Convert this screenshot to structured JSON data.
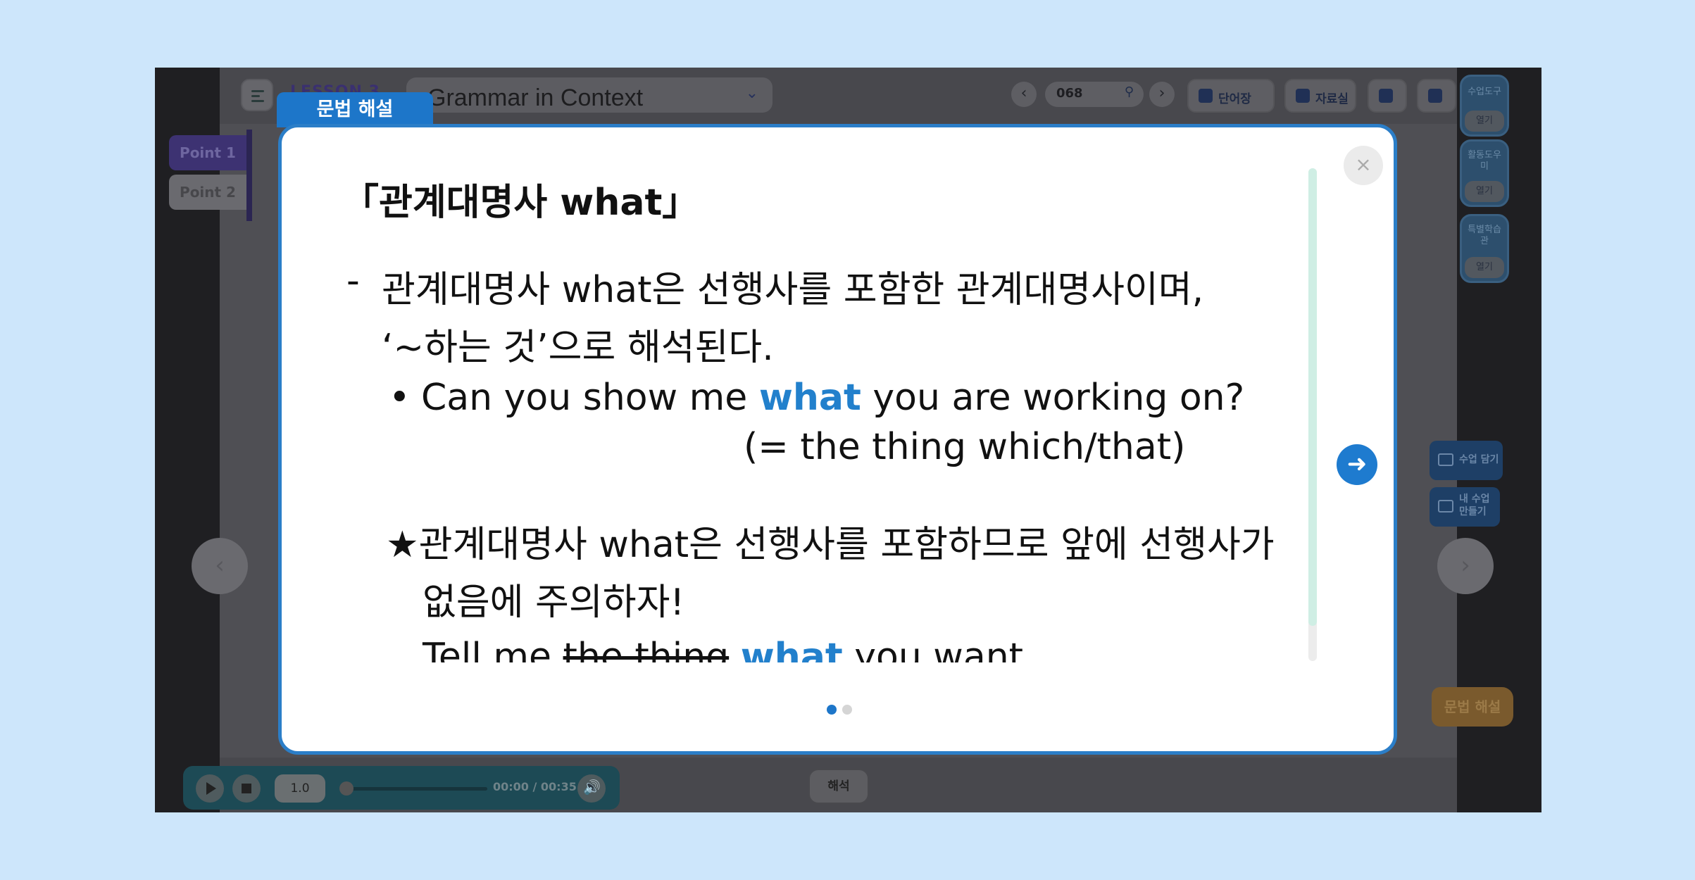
{
  "header": {
    "lesson_label": "LESSON 3",
    "lesson_title": "Grammar in Context",
    "page_number": "068",
    "tools": [
      {
        "label": "단어장"
      },
      {
        "label": "자료실"
      }
    ]
  },
  "points": [
    {
      "label": "Point 1",
      "color": "#3d3272"
    },
    {
      "label": "Point 2",
      "color": "#6a6a6f"
    }
  ],
  "right_rail": [
    {
      "label_top": "수업도구",
      "label_open": "열기"
    },
    {
      "label_top": "활동도우미",
      "label_open": "열기"
    },
    {
      "label_top": "특별학습관",
      "label_open": "열기"
    }
  ],
  "side_buttons": [
    {
      "label": "수업 담기"
    },
    {
      "label": "내 수업 만들기"
    }
  ],
  "grammar_tag": "문법 해설",
  "audio": {
    "speed": "1.0",
    "time": "00:00 / 00:35"
  },
  "interpret_button": "해석",
  "modal": {
    "tab_label": "문법 해설",
    "title": "「관계대명사 what」",
    "dash": "-",
    "line1": "관계대명사 what은 선행사를 포함한 관계대명사이며,",
    "line2": "‘~하는 것’으로 해석된다.",
    "bullet": "•",
    "example1_pre": "Can you show me ",
    "example1_hl": "what",
    "example1_post": " you are working on?",
    "example1_note": "(= the thing which/that)",
    "star_line1": "★관계대명사 what은 선행사를 포함하므로 앞에 선행사가",
    "star_line2": "없음에 주의하자!",
    "example2_pre": "Tell me ",
    "example2_strike": "the thing",
    "example2_hl": "what",
    "example2_post": " you want.",
    "active_page": 1,
    "page_count": 2,
    "accent_color": "#1d76c9"
  }
}
